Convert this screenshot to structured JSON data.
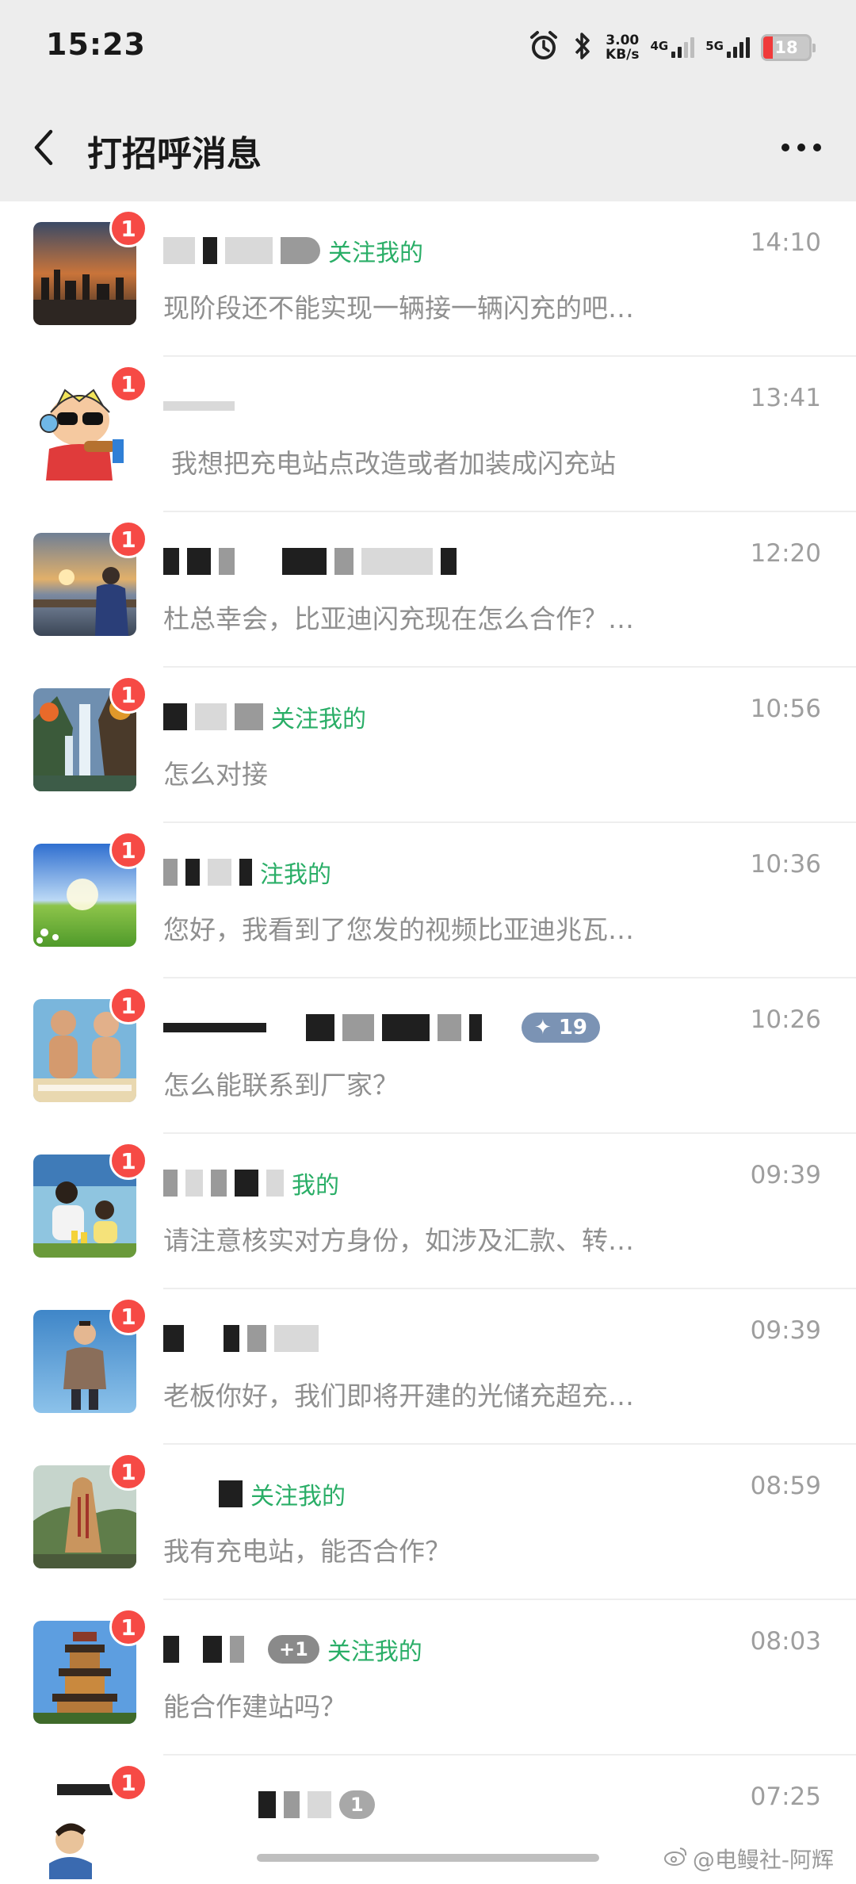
{
  "status_bar": {
    "time": "15:23",
    "speed_value": "3.00",
    "speed_unit": "KB/s",
    "net_4g": "4G",
    "net_5g": "5G",
    "battery": "18"
  },
  "header": {
    "title": "打招呼消息"
  },
  "messages": [
    {
      "follow_label": "关注我的",
      "time": "14:10",
      "preview": "现阶段还不能实现一辆接一辆闪充的吧…"
    },
    {
      "follow_label": "",
      "time": "13:41",
      "preview": "我想把充电站点改造或者加装成闪充站"
    },
    {
      "follow_label": "",
      "time": "12:20",
      "preview": "杜总幸会，比亚迪闪充现在怎么合作？…"
    },
    {
      "follow_label": "关注我的",
      "time": "10:56",
      "preview": "怎么对接"
    },
    {
      "follow_label": "注我的",
      "time": "10:36",
      "preview": "您好，我看到了您发的视频比亚迪兆瓦…"
    },
    {
      "follow_label": "",
      "tag": "19",
      "time": "10:26",
      "preview": "怎么能联系到厂家？"
    },
    {
      "follow_label": "我的",
      "time": "09:39",
      "preview": "请注意核实对方身份，如涉及汇款、转…"
    },
    {
      "follow_label": "",
      "time": "09:39",
      "preview": "老板你好，我们即将开建的光储充超充…"
    },
    {
      "follow_label": "关注我的",
      "time": "08:59",
      "preview": "我有充电站，能否合作？"
    },
    {
      "follow_label": "关注我的",
      "tag": "+1",
      "time": "08:03",
      "preview": "能合作建站吗？"
    },
    {
      "follow_label": "",
      "tag": "1",
      "time": "07:25",
      "preview": ""
    }
  ],
  "unread_badge": "1",
  "watermark": "@电鳗社-阿辉",
  "colors": {
    "follow_green": "#2aae67",
    "badge_red": "#f64a45",
    "header_bg": "#ededed"
  }
}
